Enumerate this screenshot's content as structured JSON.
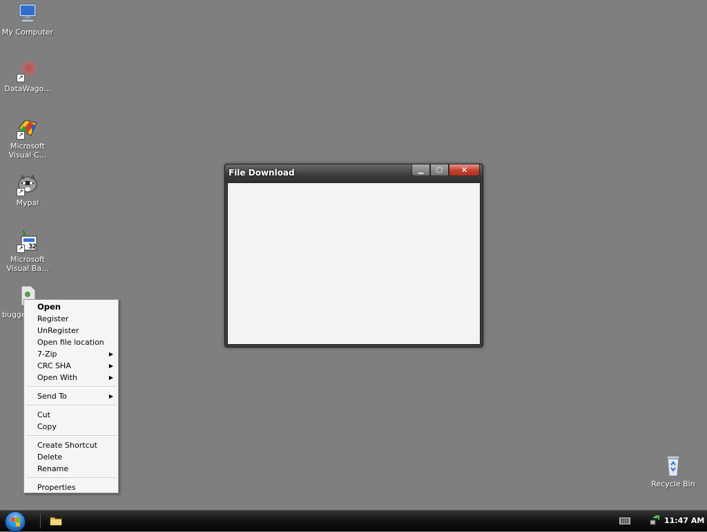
{
  "desktop": {
    "icons": [
      {
        "label": "My Computer",
        "icon": "computer-icon"
      },
      {
        "label": "DataWago...",
        "icon": "datawagon-icon"
      },
      {
        "label": "Microsoft Visual C...",
        "icon": "visual-c-icon"
      },
      {
        "label": "Mypal",
        "icon": "mypal-raccoon-icon"
      },
      {
        "label": "Microsoft Visual Ba...",
        "icon": "visual-basic-icon"
      },
      {
        "label": "bugge",
        "icon": "file-icon"
      },
      {
        "label": "Recycle Bin",
        "icon": "recycle-bin-icon"
      }
    ]
  },
  "window": {
    "title": "File Download",
    "minimize_label": "▁",
    "maximize_label": "▢",
    "close_label": "✕"
  },
  "context_menu": {
    "items": [
      {
        "label": "Open",
        "bold": true
      },
      {
        "label": "Register"
      },
      {
        "label": "UnRegister"
      },
      {
        "label": "Open file location"
      },
      {
        "label": "7-Zip",
        "submenu": true
      },
      {
        "label": "CRC SHA",
        "submenu": true
      },
      {
        "label": "Open With",
        "submenu": true
      },
      {
        "label": "Send To",
        "submenu": true
      },
      {
        "label": "Cut"
      },
      {
        "label": "Copy"
      },
      {
        "label": "Create Shortcut"
      },
      {
        "label": "Delete"
      },
      {
        "label": "Rename"
      },
      {
        "label": "Properties"
      }
    ],
    "submenu_arrow": "▶"
  },
  "taskbar": {
    "clock": "11:47 AM",
    "start_icon": "windows-orb-icon",
    "quick_launch_icon": "folder-icon"
  },
  "colors": {
    "desktop_bg": "#7f7f7f",
    "close_button": "#c0402a",
    "menu_bg": "#f5f5f5"
  }
}
